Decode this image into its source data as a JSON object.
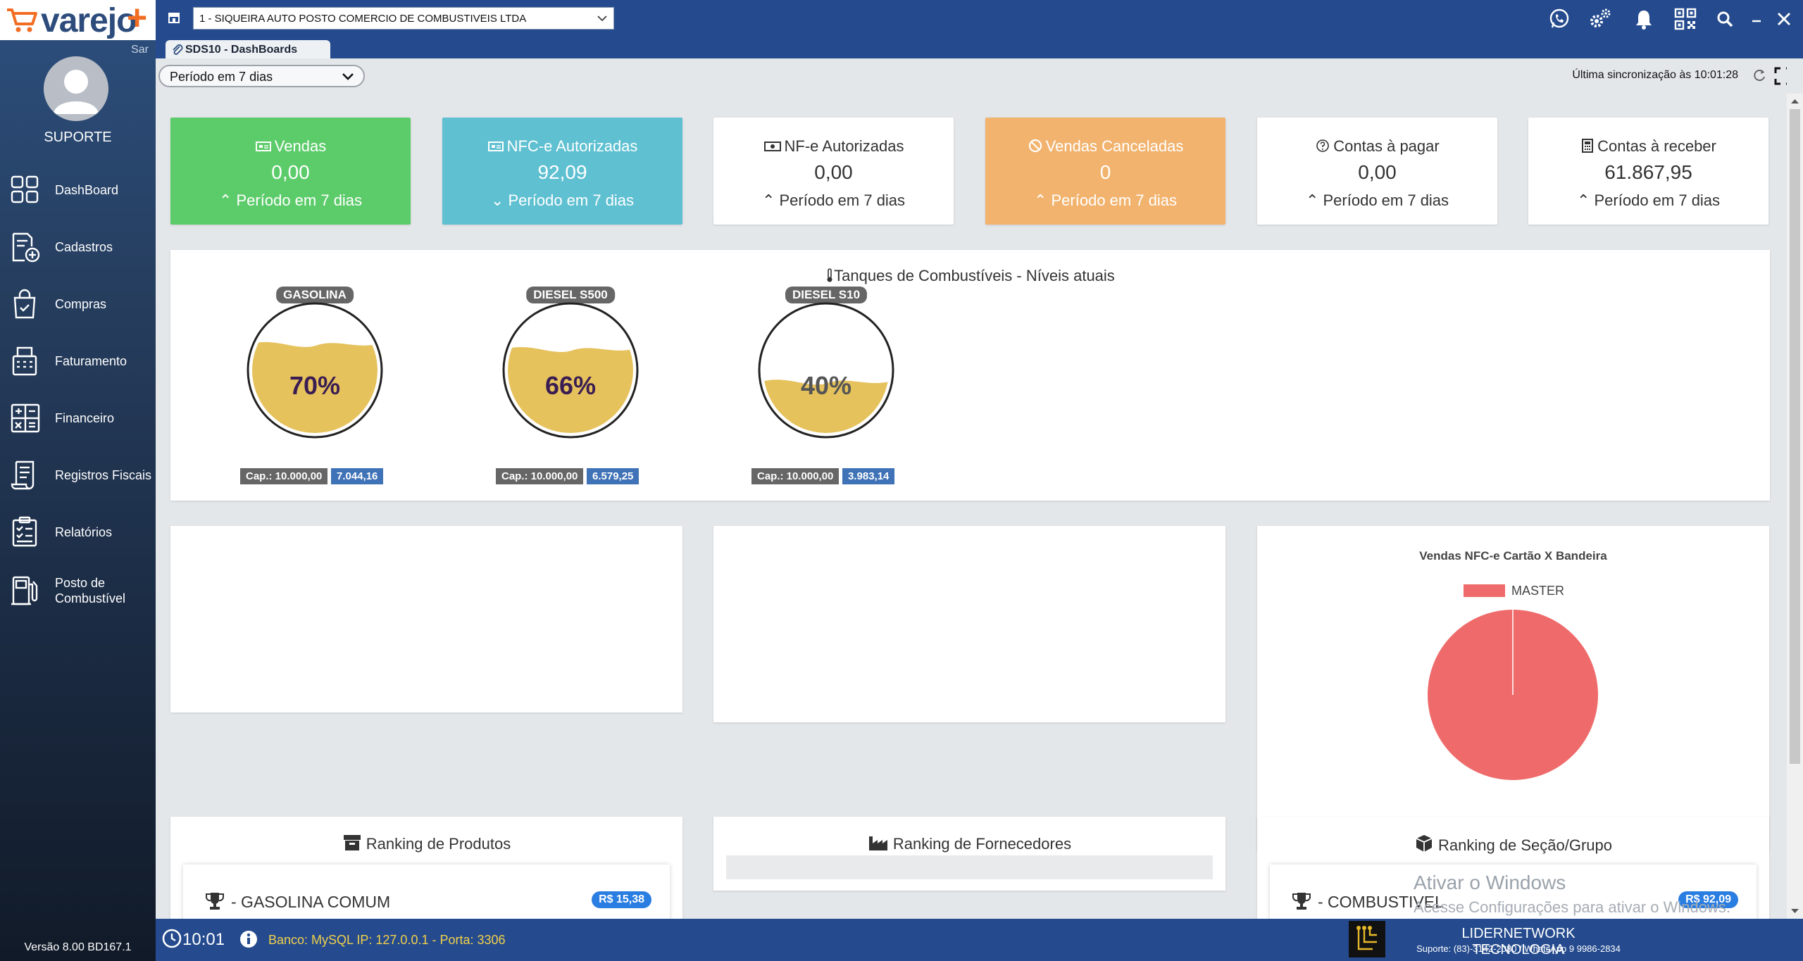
{
  "app": {
    "logo_text": "varejo",
    "logo_plus": "+",
    "logo_sub": "Sar",
    "user_name": "SUPORTE",
    "version": "Versão 8.00 BD167.1"
  },
  "sidebar": {
    "items": [
      {
        "label": "DashBoard",
        "icon": "dashboard-icon"
      },
      {
        "label": "Cadastros",
        "icon": "add-document-icon"
      },
      {
        "label": "Compras",
        "icon": "shopping-bag-icon"
      },
      {
        "label": "Faturamento",
        "icon": "cash-register-icon"
      },
      {
        "label": "Financeiro",
        "icon": "calculator-icon"
      },
      {
        "label": "Registros Fiscais",
        "icon": "receipt-icon"
      },
      {
        "label": "Relatórios",
        "icon": "report-icon"
      },
      {
        "label": "Posto de",
        "label2": "Combustível",
        "icon": "fuel-pump-icon"
      }
    ]
  },
  "topbar": {
    "company": "1 - SIQUEIRA AUTO POSTO COMERCIO DE COMBUSTIVEIS LTDA",
    "icons": [
      "whatsapp-icon",
      "settings-icon",
      "bell-icon",
      "qrcode-icon",
      "search-icon",
      "minimize-icon",
      "close-icon"
    ]
  },
  "tab": {
    "label": "SDS10 - DashBoards"
  },
  "toolbar": {
    "period": "Período em 7 dias",
    "sync": "Última sincronização às 10:01:28"
  },
  "kpis": [
    {
      "title": "Vendas",
      "value": "0,00",
      "period": "Período em 7 dias",
      "color": "#5ccc6a"
    },
    {
      "title": "NFC-e Autorizadas",
      "value": "92,09",
      "period": "Período em 7 dias",
      "color": "#5ec0d1"
    },
    {
      "title": "NF-e Autorizadas",
      "value": "0,00",
      "period": "Período em 7 dias",
      "color": "#ffffff"
    },
    {
      "title": "Vendas Canceladas",
      "value": "0",
      "period": "Período em 7 dias",
      "color": "#f2b36e"
    },
    {
      "title": "Contas à pagar",
      "value": "0,00",
      "period": "Período em 7 dias",
      "color": "#ffffff"
    },
    {
      "title": "Contas à receber",
      "value": "61.867,95",
      "period": "Período em 7 dias",
      "color": "#ffffff"
    }
  ],
  "tanks": {
    "title": "Tanques de Combustíveis - Níveis atuais",
    "items": [
      {
        "name": "GASOLINA",
        "percent": "70%",
        "level": 0.7,
        "capacity": "Cap.: 10.000,00",
        "volume": "7.044,16"
      },
      {
        "name": "DIESEL S500",
        "percent": "66%",
        "level": 0.66,
        "capacity": "Cap.: 10.000,00",
        "volume": "6.579,25"
      },
      {
        "name": "DIESEL S10",
        "percent": "40%",
        "level": 0.4,
        "capacity": "Cap.: 10.000,00",
        "volume": "3.983,14"
      }
    ]
  },
  "chart_data": {
    "type": "pie",
    "title": "Vendas NFC-e Cartão X Bandeira",
    "categories": [
      "MASTER"
    ],
    "values": [
      92.09
    ],
    "colors": [
      "#ef6b6b"
    ],
    "legend": "top"
  },
  "rankings": [
    {
      "title": "Ranking de Produtos",
      "item": "- GASOLINA COMUM",
      "value": "R$ 15,38"
    },
    {
      "title": "Ranking de Fornecedores"
    },
    {
      "title": "Ranking de Seção/Grupo",
      "item": "- COMBUSTIVEL",
      "value": "R$ 92,09"
    }
  ],
  "watermark": {
    "line1": "Ativar o Windows",
    "line2": "Acesse Configurações para ativar o Windows."
  },
  "statusbar": {
    "time": "10:01",
    "db": "Banco: MySQL IP: 127.0.0.1 - Porta: 3306",
    "company": "LIDERNETWORK TECNOLOGIA",
    "support": "Suporte: (83)-3142-2080 / WhatsApp 9 9986-2834"
  }
}
